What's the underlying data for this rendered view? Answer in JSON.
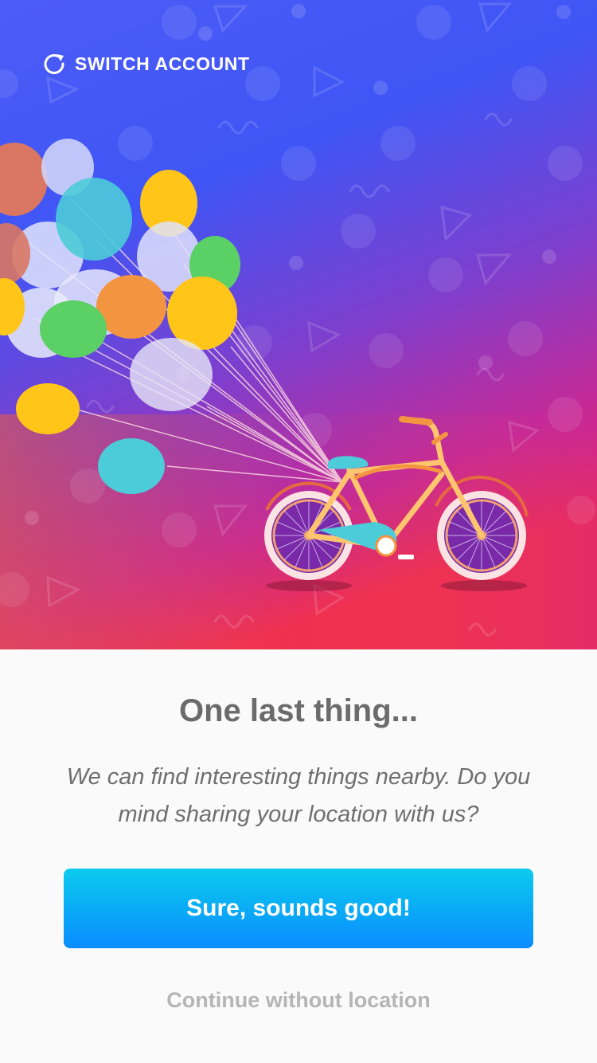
{
  "header": {
    "switch_account_label": "SWITCH ACCOUNT",
    "switch_account_icon": "refresh-icon"
  },
  "illustration": {
    "subject": "bicycle-with-balloons",
    "gradient_colors": [
      "#4d5cf6",
      "#3f55f5",
      "#8b3fc9",
      "#e9246c",
      "#f04a3b"
    ],
    "balloon_colors": [
      "#ffc619",
      "#4ccbd8",
      "#5bd065",
      "#f39540",
      "#d5d9fb"
    ]
  },
  "content": {
    "title": "One last thing...",
    "message": "We can find interesting things nearby. Do you mind sharing your location with us?"
  },
  "actions": {
    "primary_label": "Sure, sounds good!",
    "secondary_label": "Continue without location"
  },
  "colors": {
    "primary_button_top": "#0bcbed",
    "primary_button_bottom": "#0a8cff",
    "title_text": "#6b6b6b",
    "secondary_text": "#b5b5b5"
  }
}
